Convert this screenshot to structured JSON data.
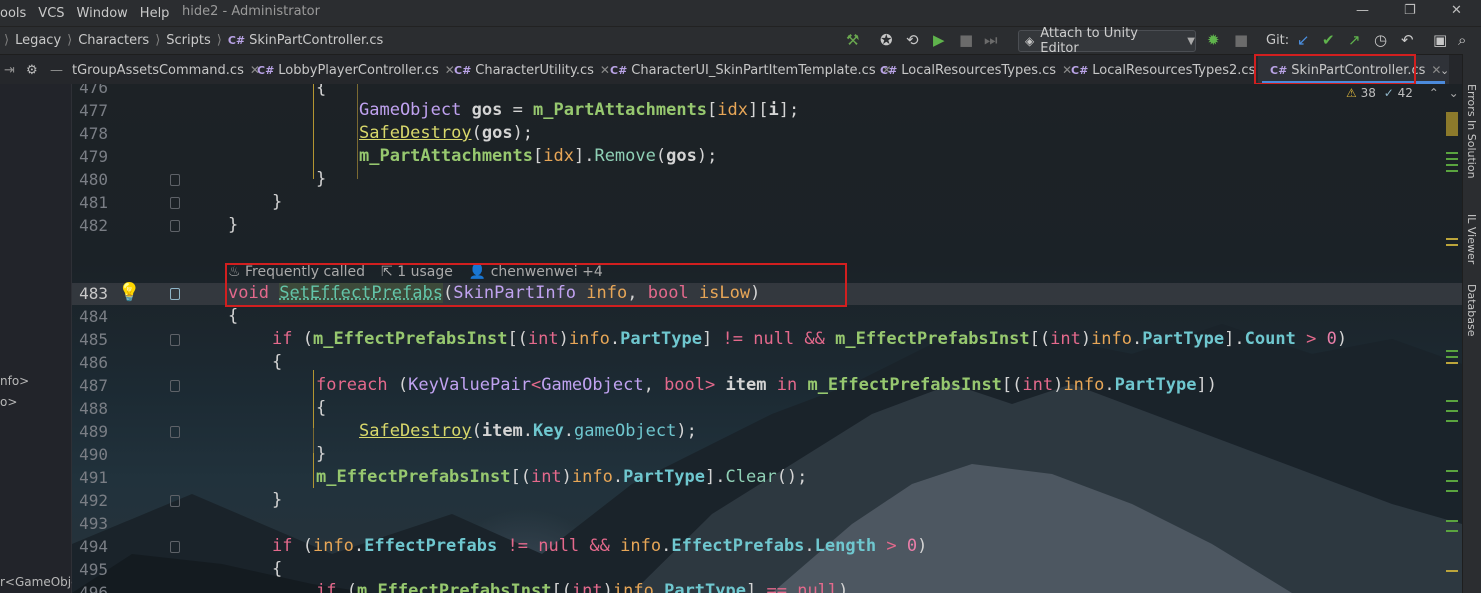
{
  "menu": {
    "items": [
      "ools",
      "VCS",
      "Window",
      "Help"
    ],
    "title": "hide2 - Administrator"
  },
  "window": {
    "minimize": "—",
    "maximize": "❐",
    "close": "✕"
  },
  "breadcrumb": {
    "items": [
      "Legacy",
      "Characters",
      "Scripts"
    ],
    "file": "SkinPartController.cs",
    "lang_badge": "C#"
  },
  "toolbar": {
    "attach_label": "Attach to Unity Editor",
    "git_label": "Git:"
  },
  "tabs": [
    {
      "label": "tGroupAssetsCommand.cs",
      "active": false
    },
    {
      "label": "LobbyPlayerController.cs",
      "active": false
    },
    {
      "label": "CharacterUtility.cs",
      "active": false
    },
    {
      "label": "CharacterUI_SkinPartItemTemplate.cs",
      "active": false
    },
    {
      "label": "LocalResourcesTypes.cs",
      "active": false
    },
    {
      "label": "LocalResourcesTypes2.cs",
      "active": false
    },
    {
      "label": "SkinPartController.cs",
      "active": true
    }
  ],
  "inspections": {
    "warnings": "38",
    "weak_warnings": "42"
  },
  "side_panels": [
    "Errors In Solution",
    "IL Viewer",
    "Database"
  ],
  "left_panel": {
    "lines": [
      "nfo>",
      "o>",
      "r<GameObje"
    ]
  },
  "codelens": {
    "frequency": "Frequently called",
    "usages": "1 usage",
    "author": "chenwenwei +4"
  },
  "line_numbers": [
    "476",
    "477",
    "478",
    "479",
    "480",
    "481",
    "482",
    "483",
    "484",
    "485",
    "486",
    "487",
    "488",
    "489",
    "490",
    "491",
    "492",
    "493",
    "494",
    "495",
    "496"
  ],
  "code": {
    "l476": "{",
    "l477_var": "GameObject",
    "l477_name": "gos",
    "l477_op": " = ",
    "l477_field": "m_PartAttachments",
    "l477_idx": "idx",
    "l477_i": "i",
    "l478_fn": "SafeDestroy",
    "l478_arg": "gos",
    "l479_field": "m_PartAttachments",
    "l479_idx": "idx",
    "l479_method": "Remove",
    "l479_arg": "gos",
    "close": "}",
    "sig_void": "void",
    "sig_name": "SetEffectPrefabs",
    "sig_t1": "SkinPartInfo",
    "sig_p1": "info",
    "sig_t2": "bool",
    "sig_p2": "isLow",
    "if": "if",
    "field_inst": "m_EffectPrefabsInst",
    "int": "int",
    "info": "info",
    "parttype": "PartType",
    "null": "null",
    "count": "Count",
    "zero": "0",
    "foreach": "foreach",
    "kvp": "KeyValuePair",
    "gameobject": "GameObject",
    "bool": "bool",
    "item": "item",
    "in": "in",
    "key": "Key",
    "gameObject": "gameObject",
    "clear": "Clear",
    "effectprefabs": "EffectPrefabs",
    "length": "Length"
  }
}
